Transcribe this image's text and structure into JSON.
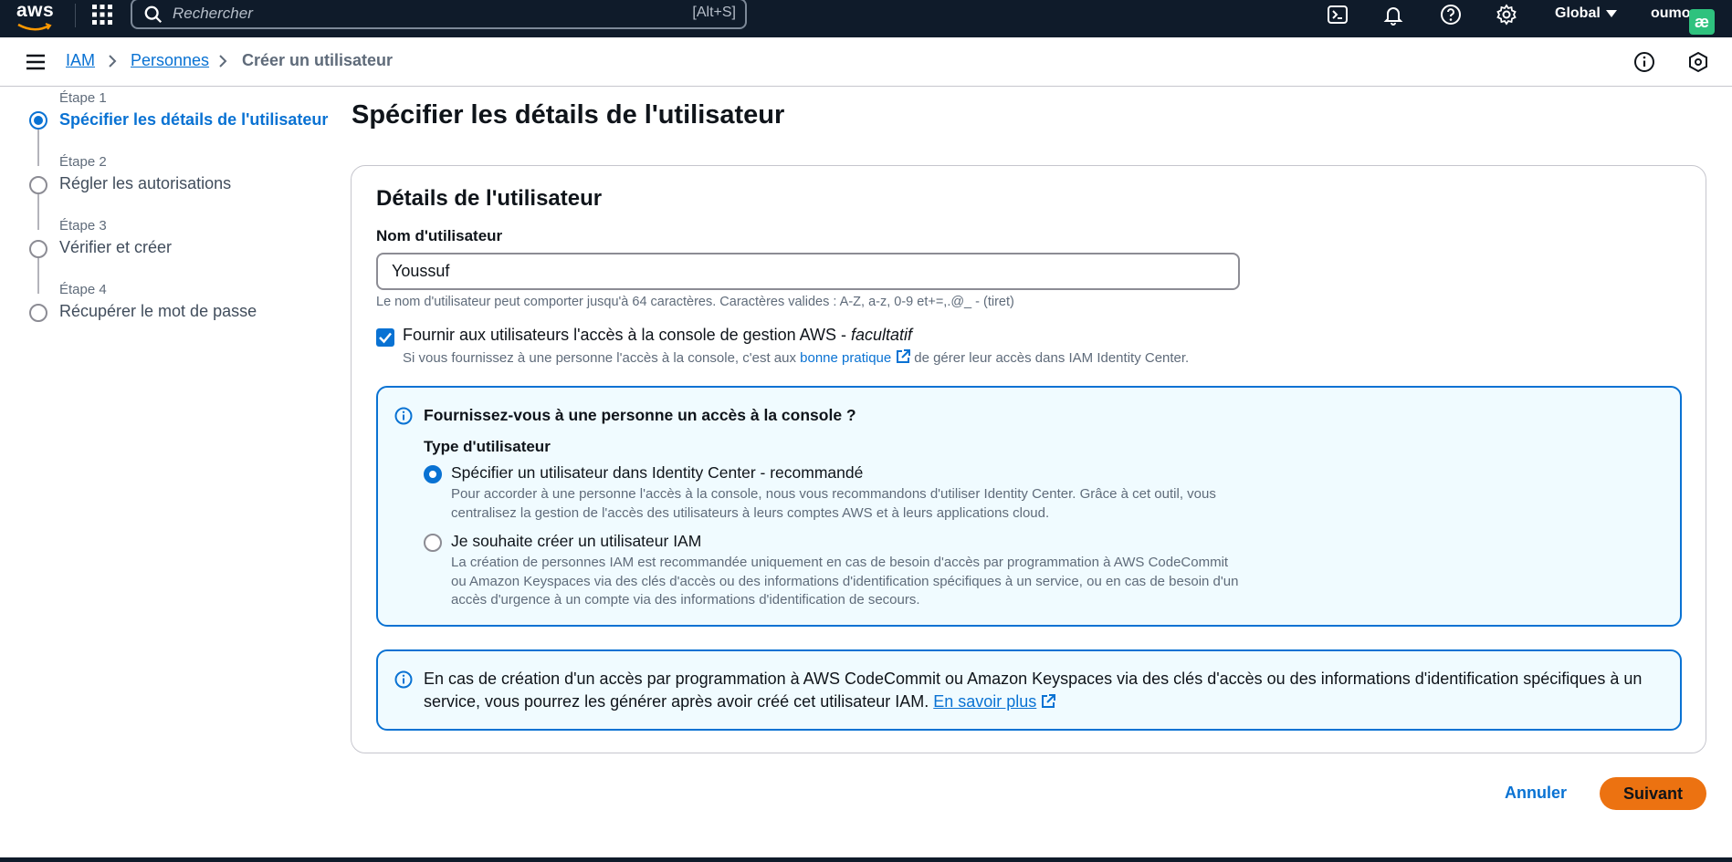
{
  "topbar": {
    "logo": "aws",
    "search_placeholder": "Rechercher",
    "search_shortcut": "[Alt+S]",
    "region": "Global",
    "account": "oumo",
    "badge": "æ"
  },
  "breadcrumb": {
    "items": [
      "IAM",
      "Personnes"
    ],
    "current": "Créer un utilisateur"
  },
  "steps": [
    {
      "label": "Étape 1",
      "title": "Spécifier les détails de l'utilisateur",
      "active": true
    },
    {
      "label": "Étape 2",
      "title": "Régler les autorisations",
      "active": false
    },
    {
      "label": "Étape 3",
      "title": "Vérifier et créer",
      "active": false
    },
    {
      "label": "Étape 4",
      "title": "Récupérer le mot de passe",
      "active": false
    }
  ],
  "page_title": "Spécifier les détails de l'utilisateur",
  "card": {
    "title": "Détails de l'utilisateur",
    "username_label": "Nom d'utilisateur",
    "username_value": "Youssuf",
    "username_hint": "Le nom d'utilisateur peut comporter jusqu'à 64 caractères. Caractères valides : A-Z, a-z, 0-9 et+=,.@_ - (tiret)",
    "console_access_label": "Fournir aux utilisateurs l'accès à la console de gestion AWS - ",
    "console_access_optional": "facultatif",
    "console_desc_before": "Si vous fournissez à une personne l'accès à la console, c'est aux ",
    "console_desc_link": "bonne pratique",
    "console_desc_after": "de gérer leur accès dans IAM Identity Center."
  },
  "info_box": {
    "title": "Fournissez-vous à une personne un accès à la console ?",
    "user_type_label": "Type d'utilisateur",
    "option1_label": "Spécifier un utilisateur dans Identity Center - recommandé",
    "option1_desc": "Pour accorder à une personne l'accès à la console, nous vous recommandons d'utiliser Identity Center. Grâce à cet outil, vous centralisez la gestion de l'accès des utilisateurs à leurs comptes AWS et à leurs applications cloud.",
    "option2_label": "Je souhaite créer un utilisateur IAM",
    "option2_desc": "La création de personnes IAM est recommandée uniquement en cas de besoin d'accès par programmation à AWS CodeCommit ou Amazon Keyspaces via des clés d'accès ou des informations d'identification spécifiques à un service, ou en cas de besoin d'un accès d'urgence à un compte via des informations d'identification de secours."
  },
  "info_box2": {
    "text": "En cas de création d'un accès par programmation à AWS CodeCommit ou Amazon Keyspaces via des clés d'accès ou des informations d'identification spécifiques à un service, vous pourrez les générer après avoir créé cet utilisateur IAM. ",
    "link": "En savoir plus"
  },
  "actions": {
    "cancel": "Annuler",
    "next": "Suivant"
  },
  "colors": {
    "accent": "#0972d3",
    "primary_button": "#ec7211",
    "topbar": "#0f1b2a"
  }
}
